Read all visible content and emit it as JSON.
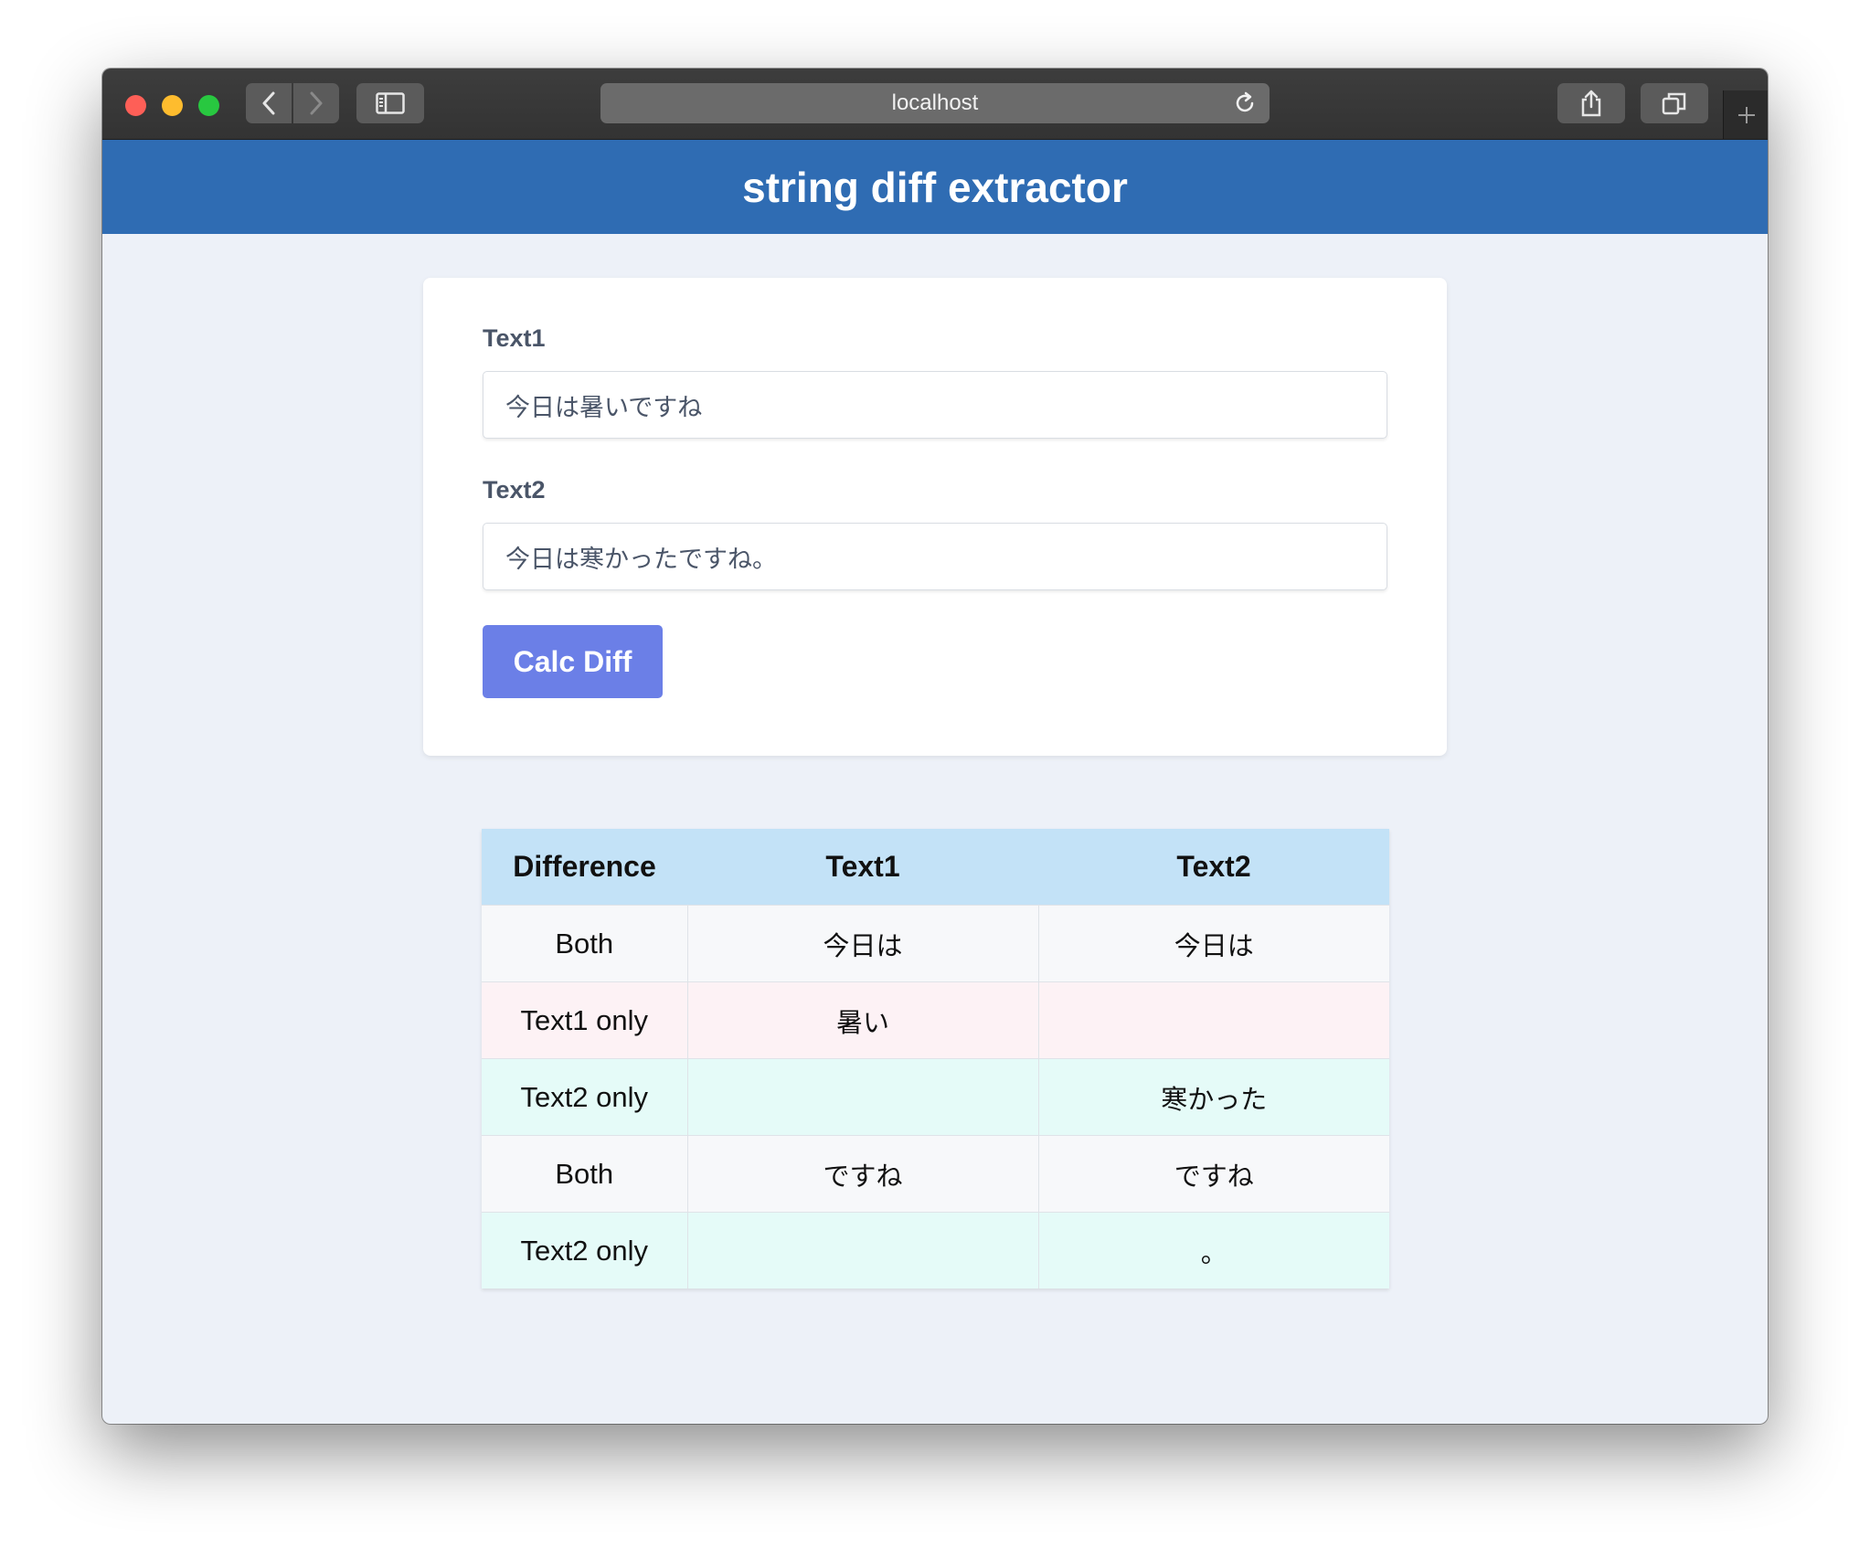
{
  "browser": {
    "url": "localhost"
  },
  "app": {
    "title": "string diff extractor"
  },
  "form": {
    "text1_label": "Text1",
    "text1_value": "今日は暑いですね",
    "text2_label": "Text2",
    "text2_value": "今日は寒かったですね。",
    "button_label": "Calc Diff"
  },
  "table": {
    "headers": [
      "Difference",
      "Text1",
      "Text2"
    ],
    "rows": [
      {
        "difference": "Both",
        "text1": "今日は",
        "text2": "今日は"
      },
      {
        "difference": "Text1 only",
        "text1": "暑い",
        "text2": ""
      },
      {
        "difference": "Text2 only",
        "text1": "",
        "text2": "寒かった"
      },
      {
        "difference": "Both",
        "text1": "ですね",
        "text2": "ですね"
      },
      {
        "difference": "Text2 only",
        "text1": "",
        "text2": "。"
      }
    ]
  },
  "colors": {
    "header_bar": "#2f6cb3",
    "button": "#6b7fe7",
    "table_header": "#c3e2f7",
    "both_row": "#f7f8fa",
    "text1_only_row": "#fdf2f5",
    "text2_only_row": "#e5fbf8"
  }
}
